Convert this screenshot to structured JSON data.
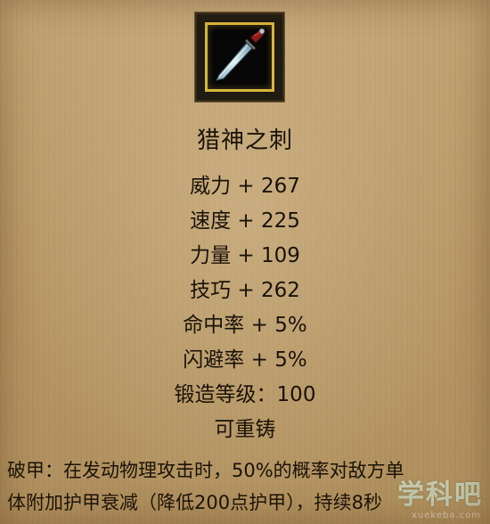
{
  "item": {
    "icon": "knife-icon",
    "name": "猎神之刺"
  },
  "stats": [
    "威力 + 267",
    "速度 + 225",
    "力量 + 109",
    "技巧 + 262",
    "命中率 + 5%",
    "闪避率 + 5%",
    "锻造等级：100",
    "可重铸"
  ],
  "description": [
    "破甲：在发动物理攻击时，50%的概率对敌方单",
    "体附加护甲衰减（降低200点护甲），持续8秒"
  ],
  "watermark": {
    "text": "学科吧",
    "sub": "xuekeba.com"
  },
  "colors": {
    "parchment": "#b89a6c",
    "frame_gold": "#d9b63a",
    "text": "#1a1208"
  }
}
